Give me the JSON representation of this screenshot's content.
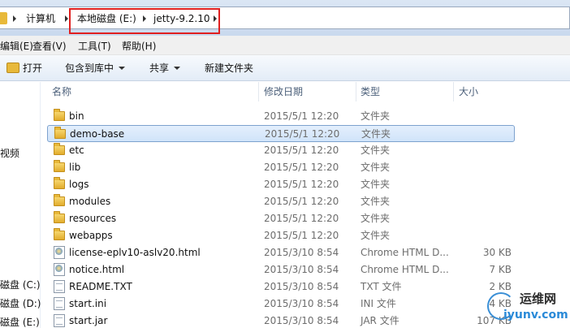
{
  "address_bar": {
    "breadcrumbs": [
      "计算机",
      "本地磁盘 (E:)",
      "jetty-9.2.10"
    ]
  },
  "menu": [
    "编辑(E)",
    "查看(V)",
    "工具(T)",
    "帮助(H)"
  ],
  "toolbar": {
    "open": "打开",
    "include_in_library": "包含到库中",
    "share": "共享",
    "new_folder": "新建文件夹"
  },
  "nav": {
    "items": [
      "视频",
      "磁盘 (C:)",
      "磁盘 (D:)",
      "磁盘 (E:)"
    ]
  },
  "columns": {
    "name": "名称",
    "date": "修改日期",
    "type": "类型",
    "size": "大小"
  },
  "files": [
    {
      "name": "bin",
      "date": "2015/5/1 12:20",
      "type": "文件夹",
      "size": "",
      "icon": "folder-icon"
    },
    {
      "name": "demo-base",
      "date": "2015/5/1 12:20",
      "type": "文件夹",
      "size": "",
      "icon": "folder-icon"
    },
    {
      "name": "etc",
      "date": "2015/5/1 12:20",
      "type": "文件夹",
      "size": "",
      "icon": "folder-icon"
    },
    {
      "name": "lib",
      "date": "2015/5/1 12:20",
      "type": "文件夹",
      "size": "",
      "icon": "folder-icon"
    },
    {
      "name": "logs",
      "date": "2015/5/1 12:20",
      "type": "文件夹",
      "size": "",
      "icon": "folder-icon"
    },
    {
      "name": "modules",
      "date": "2015/5/1 12:20",
      "type": "文件夹",
      "size": "",
      "icon": "folder-icon"
    },
    {
      "name": "resources",
      "date": "2015/5/1 12:20",
      "type": "文件夹",
      "size": "",
      "icon": "folder-icon"
    },
    {
      "name": "webapps",
      "date": "2015/5/1 12:20",
      "type": "文件夹",
      "size": "",
      "icon": "folder-icon"
    },
    {
      "name": "license-eplv10-aslv20.html",
      "date": "2015/3/10 8:54",
      "type": "Chrome HTML D...",
      "size": "30 KB",
      "icon": "html-file-icon"
    },
    {
      "name": "notice.html",
      "date": "2015/3/10 8:54",
      "type": "Chrome HTML D...",
      "size": "7 KB",
      "icon": "html-file-icon"
    },
    {
      "name": "README.TXT",
      "date": "2015/3/10 8:54",
      "type": "TXT 文件",
      "size": "2 KB",
      "icon": "text-file-icon"
    },
    {
      "name": "start.ini",
      "date": "2015/3/10 8:54",
      "type": "INI 文件",
      "size": "4 KB",
      "icon": "ini-file-icon"
    },
    {
      "name": "start.jar",
      "date": "2015/3/10 8:54",
      "type": "JAR 文件",
      "size": "107 KB",
      "icon": "jar-file-icon"
    }
  ],
  "selected_file": "demo-base",
  "watermark": {
    "title": "运维网",
    "url": "iyunv.com"
  },
  "colors": {
    "highlight_border": "#e02020",
    "selection_fill": "#d8e8fb",
    "selection_border": "#7da2ce"
  }
}
